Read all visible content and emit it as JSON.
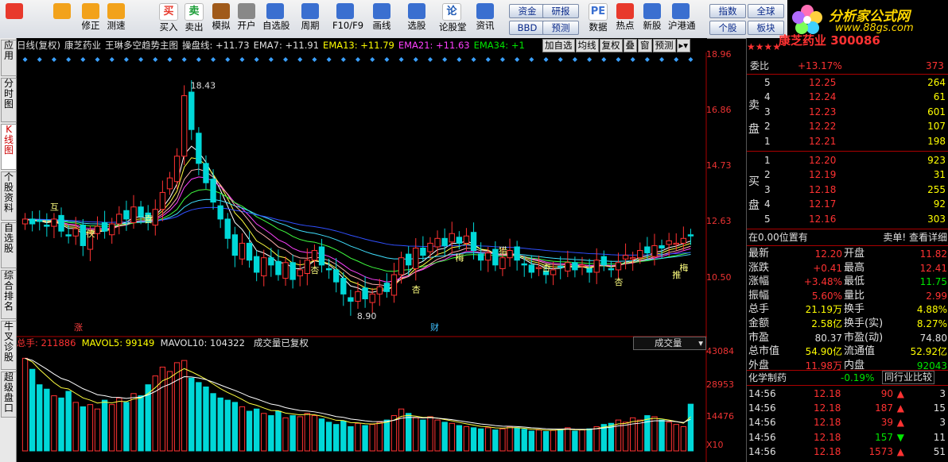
{
  "toolbar": {
    "buttons": [
      {
        "label": "",
        "icon": "home-icon"
      },
      {
        "label": "",
        "icon": "back-arrow-icon"
      },
      {
        "label": "修正",
        "icon": "refresh-icon"
      },
      {
        "label": "测速",
        "icon": "stopwatch-icon"
      },
      {
        "label": "买入",
        "icon": "buy-icon",
        "glyph": "买"
      },
      {
        "label": "卖出",
        "icon": "sell-icon",
        "glyph": "卖"
      },
      {
        "label": "模拟",
        "icon": "hammer-icon"
      },
      {
        "label": "开户",
        "icon": "lock-icon"
      },
      {
        "label": "自选股",
        "icon": "star-folder-icon"
      },
      {
        "label": "周期",
        "icon": "clock-icon"
      },
      {
        "label": "F10/F9",
        "icon": "f10-icon"
      },
      {
        "label": "画线",
        "icon": "pencil-icon"
      },
      {
        "label": "选股",
        "icon": "monitor-icon"
      },
      {
        "label": "论股堂",
        "icon": "lun-icon",
        "glyph": "论"
      },
      {
        "label": "资讯",
        "icon": "news-icon"
      },
      {
        "label": "数据",
        "icon": "pe-icon",
        "glyph": "PE"
      },
      {
        "label": "热点",
        "icon": "hot-icon"
      },
      {
        "label": "新股",
        "icon": "ipo-icon"
      },
      {
        "label": "沪港通",
        "icon": "hk-icon"
      }
    ],
    "small_buttons": [
      "资金",
      "研报",
      "BBD",
      "预测",
      "指数",
      "全球",
      "个股",
      "板块"
    ]
  },
  "logo": {
    "title": "分析家公式网",
    "url": "www.88gs.com"
  },
  "side_tabs": [
    "应用",
    "分时图",
    "K线图",
    "个股资料",
    "自选股",
    "综合排名",
    "牛叉诊股",
    "超级盘口"
  ],
  "header": {
    "period": "日线(复权)",
    "stock": "康芝药业",
    "formula": "王琳多空趋势主图",
    "ind1": "操盘线: +11.73",
    "ema7": "EMA7: +11.91",
    "ema13": "EMA13: +11.79",
    "ema21": "EMA21: +11.63",
    "ema34": "EMA34: +1",
    "btns": [
      "加自选",
      "均线",
      "复权",
      "叠",
      "窗",
      "预测"
    ]
  },
  "price_axis": [
    "18.96",
    "16.86",
    "14.73",
    "12.63",
    "10.50"
  ],
  "annotations": {
    "high": "18.43",
    "low": "8.90",
    "zhang": "涨",
    "cai": "财"
  },
  "markers": [
    "互",
    "侠",
    "喜",
    "杏",
    "杏",
    "梅",
    "猎",
    "杏",
    "杏",
    "推",
    "梅"
  ],
  "volume": {
    "total": "总手: 211886",
    "mavol5": "MAVOL5: 99149",
    "mavol10": "MAVOL10: 104322",
    "note": "成交量已复权",
    "selector": "成交量",
    "axis": [
      "43084",
      "28953",
      "14476",
      "X10"
    ]
  },
  "quote": {
    "code_title": "康芝药业 300086",
    "weibi_label": "委比",
    "weibi": "+13.17%",
    "weibi_vol": "373",
    "sell_label": "卖盘",
    "buy_label": "买盘",
    "sell": [
      {
        "n": "5",
        "p": "12.25",
        "v": "264"
      },
      {
        "n": "4",
        "p": "12.24",
        "v": "61"
      },
      {
        "n": "3",
        "p": "12.23",
        "v": "601"
      },
      {
        "n": "2",
        "p": "12.22",
        "v": "107"
      },
      {
        "n": "1",
        "p": "12.21",
        "v": "198"
      }
    ],
    "buy": [
      {
        "n": "1",
        "p": "12.20",
        "v": "923"
      },
      {
        "n": "2",
        "p": "12.19",
        "v": "31"
      },
      {
        "n": "3",
        "p": "12.18",
        "v": "255"
      },
      {
        "n": "4",
        "p": "12.17",
        "v": "92"
      },
      {
        "n": "5",
        "p": "12.16",
        "v": "303"
      }
    ],
    "status_left": "在0.00位置有",
    "status_right": "卖单! 查看详细",
    "stats": [
      {
        "l": "最新",
        "v": "12.20",
        "l2": "开盘",
        "v2": "11.82"
      },
      {
        "l": "涨跌",
        "v": "+0.41",
        "l2": "最高",
        "v2": "12.41"
      },
      {
        "l": "涨幅",
        "v": "+3.48%",
        "l2": "最低",
        "v2": "11.75"
      },
      {
        "l": "振幅",
        "v": "5.60%",
        "l2": "量比",
        "v2": "2.99"
      },
      {
        "l": "总手",
        "v": "21.19万",
        "l2": "换手",
        "v2": "4.88%"
      },
      {
        "l": "金额",
        "v": "2.58亿",
        "l2": "换手(实)",
        "v2": "8.27%"
      },
      {
        "l": "市盈",
        "v": "80.37",
        "l2": "市盈(动)",
        "v2": "74.80"
      },
      {
        "l": "总市值",
        "v": "54.90亿",
        "l2": "流通值",
        "v2": "52.92亿"
      },
      {
        "l": "外盘",
        "v": "11.98万",
        "l2": "内盘",
        "v2": "92043"
      }
    ],
    "industry": "化学制药",
    "industry_chg": "-0.19%",
    "industry_btn": "同行业比较",
    "ticks": [
      {
        "t": "14:56",
        "p": "12.18",
        "v": "90",
        "d": "up",
        "n": "3"
      },
      {
        "t": "14:56",
        "p": "12.18",
        "v": "187",
        "d": "up",
        "n": "15"
      },
      {
        "t": "14:56",
        "p": "12.18",
        "v": "39",
        "d": "up",
        "n": "3"
      },
      {
        "t": "14:56",
        "p": "12.18",
        "v": "157",
        "d": "down",
        "n": "11"
      },
      {
        "t": "14:56",
        "p": "12.18",
        "v": "1573",
        "d": "up",
        "n": "51"
      }
    ]
  },
  "chart_data": {
    "type": "candlestick",
    "ylim": [
      8.5,
      19.2
    ],
    "close": [
      12.9,
      12.7,
      12.8,
      12.6,
      12.9,
      12.4,
      12.2,
      12.5,
      11.8,
      12.3,
      12.6,
      12.4,
      12.7,
      13.1,
      12.9,
      13.4,
      13.0,
      12.8,
      13.3,
      14.0,
      14.6,
      15.5,
      18.0,
      16.6,
      15.2,
      14.4,
      13.6,
      12.9,
      12.1,
      11.4,
      11.9,
      11.2,
      10.7,
      11.3,
      11.0,
      10.6,
      11.1,
      10.4,
      10.8,
      11.2,
      11.6,
      11.0,
      10.8,
      10.3,
      9.8,
      9.5,
      9.9,
      9.6,
      9.8,
      10.1,
      9.9,
      10.6,
      11.3,
      11.0,
      11.7,
      11.4,
      11.9,
      12.1,
      11.8,
      12.3,
      11.9,
      12.2,
      11.6,
      11.2,
      11.5,
      11.0,
      11.3,
      11.6,
      11.2,
      11.0,
      10.7,
      10.9,
      10.6,
      10.8,
      10.9,
      11.1,
      10.8,
      11.0,
      10.7,
      11.2,
      11.0,
      10.8,
      11.1,
      11.4,
      11.3,
      11.6,
      11.5,
      11.8,
      11.7,
      12.0,
      11.9,
      12.1,
      12.2
    ],
    "volume": [
      42000,
      37000,
      30000,
      28000,
      25000,
      24000,
      27000,
      22000,
      20000,
      21000,
      19000,
      23000,
      21000,
      24000,
      22000,
      26000,
      25000,
      30000,
      34000,
      38000,
      36000,
      40000,
      41000,
      33000,
      31000,
      29000,
      26000,
      24000,
      23000,
      22000,
      20000,
      18000,
      19000,
      17000,
      16000,
      18000,
      15000,
      16000,
      15500,
      17000,
      16000,
      14500,
      13000,
      12000,
      13500,
      11000,
      12500,
      11500,
      12000,
      13000,
      14000,
      16000,
      19000,
      17000,
      15000,
      14000,
      15500,
      14000,
      13000,
      12500,
      11500,
      11000,
      10500,
      10000,
      10500,
      9500,
      10000,
      11000,
      10500,
      9800,
      9000,
      9500,
      8800,
      9300,
      9800,
      10500,
      9000,
      9500,
      10000,
      11000,
      12000,
      12500,
      14000,
      13000,
      15000,
      14000,
      16000,
      15500,
      14000,
      13000,
      12000,
      11000,
      21188
    ]
  }
}
